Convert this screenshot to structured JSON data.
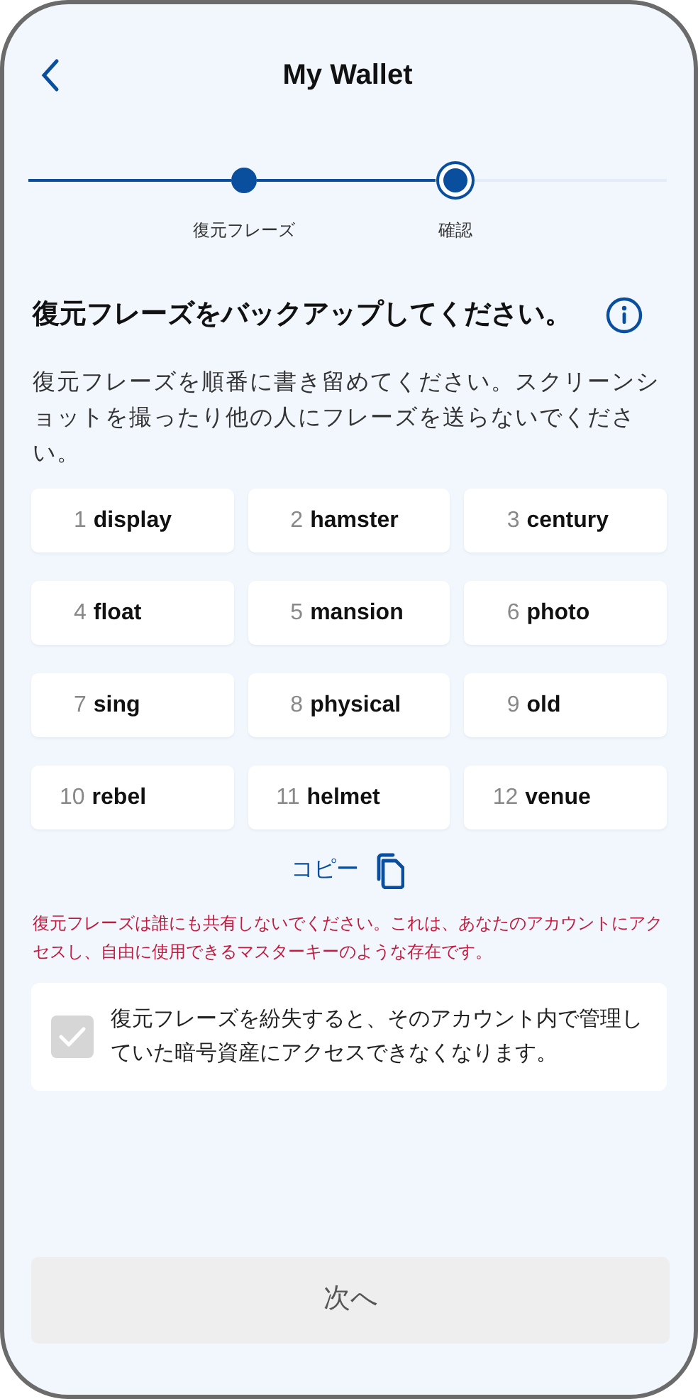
{
  "header": {
    "title": "My Wallet"
  },
  "steps": [
    {
      "label": "復元フレーズ",
      "current": false
    },
    {
      "label": "確認",
      "current": true
    }
  ],
  "heading": "復元フレーズをバックアップしてください。",
  "instructions": "復元フレーズを順番に書き留めてください。スクリーンショットを撮ったり他の人にフレーズを送らないでください。",
  "words": [
    {
      "number": "1",
      "word": "display"
    },
    {
      "number": "2",
      "word": "hamster"
    },
    {
      "number": "3",
      "word": "century"
    },
    {
      "number": "4",
      "word": "float"
    },
    {
      "number": "5",
      "word": "mansion"
    },
    {
      "number": "6",
      "word": "photo"
    },
    {
      "number": "7",
      "word": "sing"
    },
    {
      "number": "8",
      "word": "physical"
    },
    {
      "number": "9",
      "word": "old"
    },
    {
      "number": "10",
      "word": "rebel"
    },
    {
      "number": "11",
      "word": "helmet"
    },
    {
      "number": "12",
      "word": "venue"
    }
  ],
  "copy_label": "コピー",
  "warning": "復元フレーズは誰にも共有しないでください。これは、あなたのアカウントにアクセスし、自由に使用できるマスターキーのような存在です。",
  "acknowledgement": {
    "text": "復元フレーズを紛失すると、そのアカウント内で管理していた暗号資産にアクセスできなくなります。",
    "checked": true,
    "disabled": true
  },
  "next_button": {
    "label": "次へ",
    "disabled": true
  }
}
